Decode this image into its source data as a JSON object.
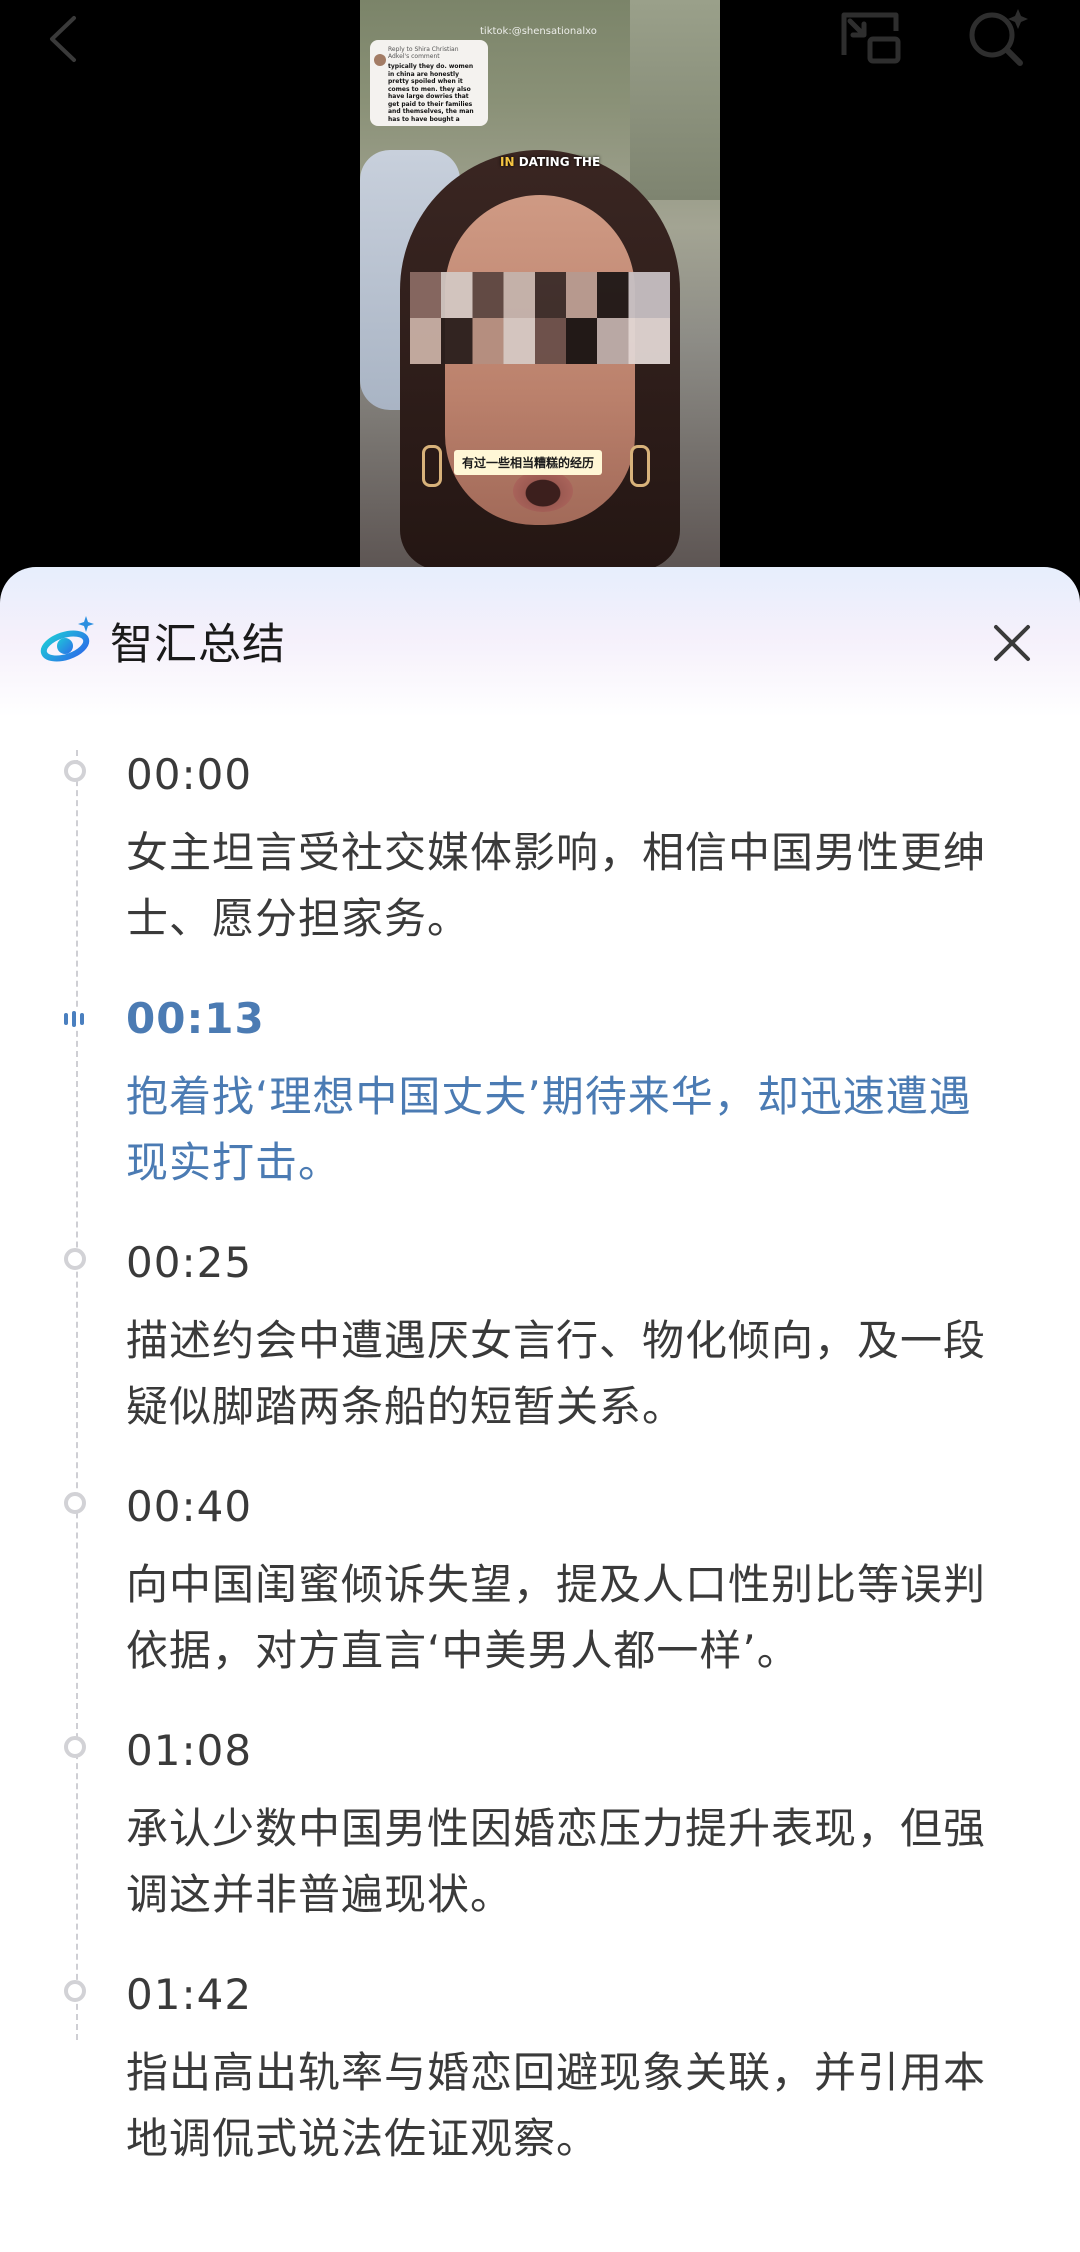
{
  "video": {
    "watermark": "tiktok:@shensationalxo",
    "comment": {
      "header": "Reply to Shira Christian Adkel's comment",
      "text": "typically they do. women in china are honestly pretty spoiled when it comes to men. they also have large dowries that get paid to their families and themselves, the man has to have bought a"
    },
    "caption_top_highlight": "IN",
    "caption_top_rest": " DATING THE",
    "caption_bottom": "有过一些相当糟糕的经历"
  },
  "summary": {
    "title": "智汇总结",
    "active_index": 1,
    "entries": [
      {
        "time": "00:00",
        "text": "女主坦言受社交媒体影响，相信中国男性更绅士、愿分担家务。"
      },
      {
        "time": "00:13",
        "text": "抱着找‘理想中国丈夫’期待来华，却迅速遭遇现实打击。"
      },
      {
        "time": "00:25",
        "text": "描述约会中遭遇厌女言行、物化倾向，及一段疑似脚踏两条船的短暂关系。"
      },
      {
        "time": "00:40",
        "text": "向中国闺蜜倾诉失望，提及人口性别比等误判依据，对方直言‘中美男人都一样’。"
      },
      {
        "time": "01:08",
        "text": "承认少数中国男性因婚恋压力提升表现，但强调这并非普遍现状。"
      },
      {
        "time": "01:42",
        "text": "指出高出轨率与婚恋回避现象关联，并引用本地调侃式说法佐证观察。"
      }
    ]
  },
  "colors": {
    "accent": "#4b7bb3",
    "text": "#3a3a3a",
    "timeline_dot": "#d2d2d6"
  },
  "icons": {
    "back": "chevron-left-icon",
    "pip": "picture-in-picture-icon",
    "search": "ai-search-icon",
    "logo": "zhihui-logo-icon",
    "close": "close-icon"
  }
}
